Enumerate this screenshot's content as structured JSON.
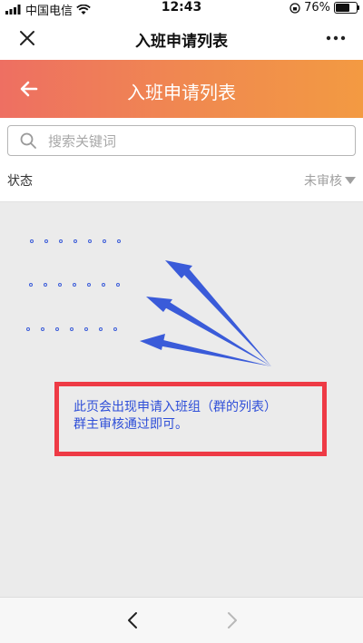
{
  "status_bar": {
    "carrier": "中国电信",
    "time": "12:43",
    "battery": "76%",
    "battery_level": 0.76
  },
  "wechat_nav": {
    "title": "入班申请列表",
    "close_icon": "close-icon",
    "more_icon": "more-icon"
  },
  "header": {
    "title": "入班申请列表",
    "back_icon": "back-arrow-icon",
    "gradient": [
      "#ee6f62",
      "#f39a42"
    ]
  },
  "search": {
    "placeholder": "搜索关键词",
    "value": ""
  },
  "filter": {
    "label": "状态",
    "selected": "未审核"
  },
  "annotation": {
    "line1": "此页会出现申请入班组（群的列表）",
    "line2": "群主审核通过即可。",
    "border_color": "#ee3a45",
    "text_color": "#2f4fd8"
  },
  "bottom_bar": {
    "back_icon": "chevron-left-icon",
    "forward_icon": "chevron-right-icon"
  }
}
